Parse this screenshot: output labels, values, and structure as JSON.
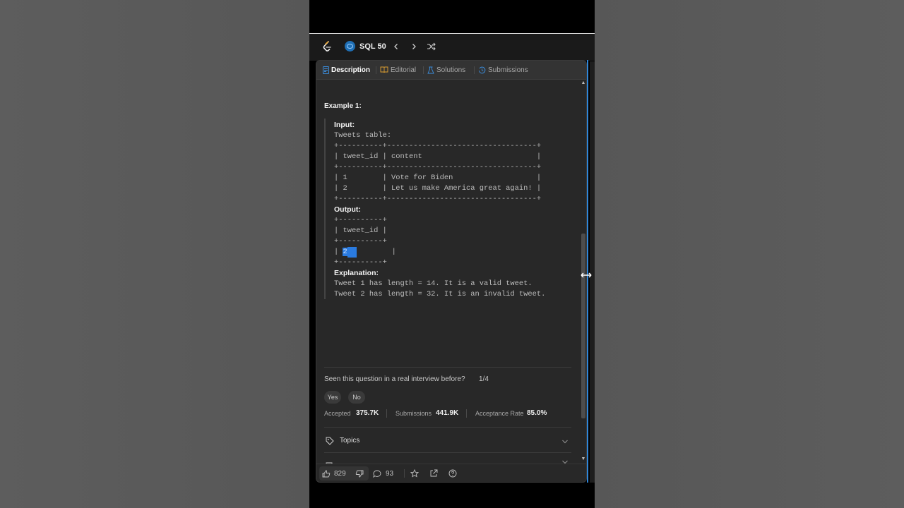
{
  "app": {
    "title": "SQL 50"
  },
  "tabs": [
    {
      "label": "Description",
      "active": true
    },
    {
      "label": "Editorial",
      "active": false
    },
    {
      "label": "Solutions",
      "active": false
    },
    {
      "label": "Submissions",
      "active": false
    }
  ],
  "example": {
    "title": "Example 1:",
    "input_label": "Input:",
    "table_caption": "Tweets table:",
    "input_table": {
      "border": "+----------+----------------------------------+",
      "header": "| tweet_id | content                          |",
      "rows": [
        "| 1        | Vote for Biden                   |",
        "| 2        | Let us make America great again! |"
      ]
    },
    "output_label": "Output:",
    "output_table": {
      "border": "+----------+",
      "header": "| tweet_id |",
      "row_prefix": "| ",
      "row_selected_value": "2",
      "row_suffix": "        |"
    },
    "explanation_label": "Explanation:",
    "explanation_lines": [
      "Tweet 1 has length = 14. It is a valid tweet.",
      "Tweet 2 has length = 32. It is an invalid tweet."
    ]
  },
  "interview": {
    "question": "Seen this question in a real interview before?",
    "count": "1/4",
    "yes_label": "Yes",
    "no_label": "No"
  },
  "stats": {
    "accepted_label": "Accepted",
    "accepted_value": "375.7K",
    "submissions_label": "Submissions",
    "submissions_value": "441.9K",
    "acceptance_label": "Acceptance Rate",
    "acceptance_value": "85.0%"
  },
  "topics": {
    "label": "Topics"
  },
  "footer": {
    "likes": "829",
    "comments": "93"
  },
  "colors": {
    "accent": "#2f86d8",
    "selection": "#2a7be0",
    "panel": "#282828"
  }
}
